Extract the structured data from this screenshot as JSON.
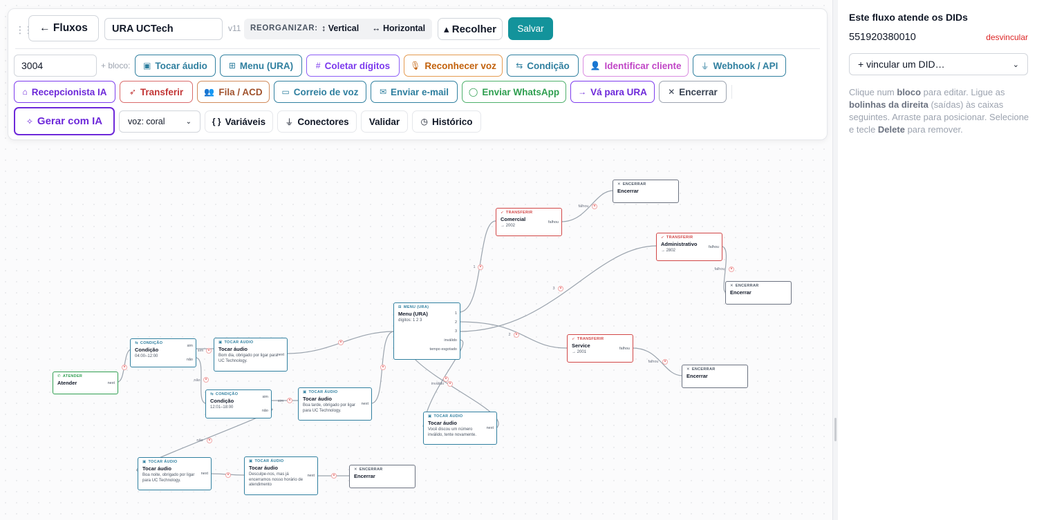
{
  "toolbar": {
    "back_label": "← Fluxos",
    "flow_name": "URA UCTech",
    "version": "v11",
    "reorg_label": "REORGANIZAR:",
    "vertical_label": "↕ Vertical",
    "horizontal_label": "↔ Horizontal",
    "collapse_label": "▴ Recolher",
    "save_label": "Salvar",
    "extension": "3004",
    "add_block_label": "+ bloco:",
    "blocks": {
      "tocar_audio": "Tocar áudio",
      "menu_ura": "Menu (URA)",
      "coletar_digitos": "Coletar dígitos",
      "reconhecer_voz": "Reconhecer voz",
      "condicao": "Condição",
      "identificar_cliente": "Identificar cliente",
      "webhook_api": "Webhook / API",
      "recepcionista_ia": "Recepcionista IA",
      "transferir": "Transferir",
      "fila_acd": "Fila / ACD",
      "correio_voz": "Correio de voz",
      "enviar_email": "Enviar e-mail",
      "enviar_whatsapp": "Enviar WhatsApp",
      "va_para_ura": "Vá para URA",
      "encerrar": "Encerrar"
    },
    "gerar_ia_label": "Gerar com IA",
    "voice_select": "voz: coral",
    "variaveis_label": "Variáveis",
    "conectores_label": "Conectores",
    "validar_label": "Validar",
    "historico_label": "Histórico"
  },
  "panel": {
    "title": "Este fluxo atende os DIDs",
    "did": "551920380010",
    "unlink_label": "desvincular",
    "link_select": "+ vincular um DID…",
    "help_1": "Clique num ",
    "help_b1": "bloco",
    "help_2": " para editar. Ligue as ",
    "help_b2": "bolinhas da direita",
    "help_3": " (saídas) às caixas seguintes. Arraste para posicionar. Selecione e tecle ",
    "help_b3": "Delete",
    "help_4": " para remover."
  },
  "nodes": {
    "atender": {
      "type": "ATENDER",
      "title": "Atender",
      "out1": "next"
    },
    "cond1": {
      "type": "CONDIÇÃO",
      "title": "Condição",
      "desc": "04:00–12:00",
      "out1": "sim",
      "out2": "não"
    },
    "audio1": {
      "type": "TOCAR ÁUDIO",
      "title": "Tocar áudio",
      "desc": "Bom dia, obrigado por ligar para UC Technology.",
      "out1": "next"
    },
    "cond2": {
      "type": "CONDIÇÃO",
      "title": "Condição",
      "desc": "12:01–18:00",
      "out1": "sim",
      "out2": "não"
    },
    "audio2": {
      "type": "TOCAR ÁUDIO",
      "title": "Tocar áudio",
      "desc": "Boa tarde, obrigado por ligar para UC Technology.",
      "out1": "next"
    },
    "audio3": {
      "type": "TOCAR ÁUDIO",
      "title": "Tocar áudio",
      "desc": "Boa noite, obrigado por ligar para UC Technology.",
      "out1": "next"
    },
    "audio4": {
      "type": "TOCAR ÁUDIO",
      "title": "Tocar áudio",
      "desc": "Desculpe-nos, mas já encerramos nosso horário de atendimento",
      "out1": "next"
    },
    "enc1": {
      "type": "ENCERRAR",
      "title": "Encerrar"
    },
    "menu": {
      "type": "MENU (URA)",
      "title": "Menu (URA)",
      "desc": "dígitos: 1 2 3",
      "o1": "1",
      "o2": "2",
      "o3": "3",
      "o4": "inválido",
      "o5": "tempo esgotado"
    },
    "audio5": {
      "type": "TOCAR ÁUDIO",
      "title": "Tocar áudio",
      "desc": "Você discou um número inválido, tente novamente.",
      "out1": "next"
    },
    "tr1": {
      "type": "TRANSFERIR",
      "title": "Comercial",
      "desc": "→ 2002",
      "out1": "falhou"
    },
    "tr2": {
      "type": "TRANSFERIR",
      "title": "Administrativo",
      "desc": "→ 2802",
      "out1": "falhou"
    },
    "tr3": {
      "type": "TRANSFERIR",
      "title": "Service",
      "desc": "→ 2001",
      "out1": "falhou"
    },
    "enc2": {
      "type": "ENCERRAR",
      "title": "Encerrar"
    },
    "enc3": {
      "type": "ENCERRAR",
      "title": "Encerrar"
    },
    "enc4": {
      "type": "ENCERRAR",
      "title": "Encerrar"
    }
  },
  "edge_labels": {
    "sim": "sim",
    "nao": "não",
    "falhou": "falhou",
    "invalido": "inválido",
    "d1": "1",
    "d2": "2",
    "d3": "3"
  }
}
